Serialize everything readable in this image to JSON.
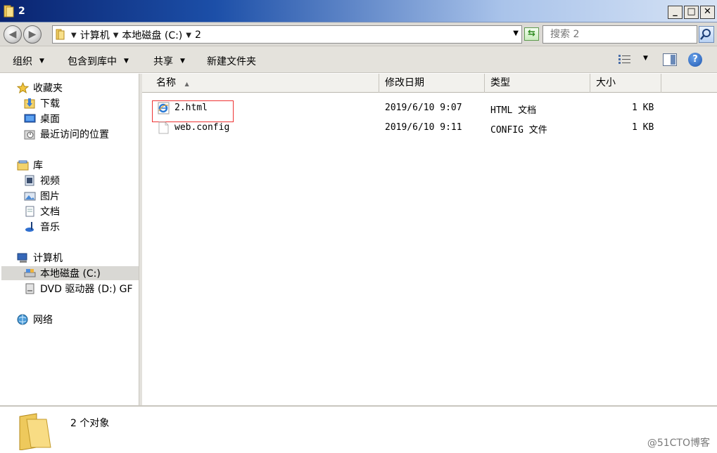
{
  "window": {
    "title": "2",
    "minimize": "_",
    "maximize": "□",
    "close": "✕"
  },
  "address": {
    "crumbs": [
      "计算机",
      "本地磁盘 (C:)",
      "2"
    ],
    "search_placeholder": "搜索 2"
  },
  "toolbar": {
    "organize": "组织",
    "include_library": "包含到库中",
    "share": "共享",
    "new_folder": "新建文件夹"
  },
  "nav": {
    "favorites": "收藏夹",
    "downloads": "下载",
    "desktop": "桌面",
    "recent": "最近访问的位置",
    "library": "库",
    "videos": "视频",
    "pictures": "图片",
    "documents": "文档",
    "music": "音乐",
    "computer": "计算机",
    "local_disk": "本地磁盘 (C:)",
    "dvd": "DVD 驱动器 (D:) GF",
    "network": "网络"
  },
  "columns": {
    "name": "名称",
    "modified": "修改日期",
    "type": "类型",
    "size": "大小"
  },
  "files": [
    {
      "name": "2.html",
      "modified": "2019/6/10 9:07",
      "type": "HTML 文档",
      "size": "1 KB",
      "icon": "ie-html-icon"
    },
    {
      "name": "web.config",
      "modified": "2019/6/10 9:11",
      "type": "CONFIG 文件",
      "size": "1 KB",
      "icon": "blank-file-icon"
    }
  ],
  "status": {
    "count_text": "2 个对象"
  },
  "watermark": "@51CTO博客",
  "colors": {
    "title_gradient_start": "#0a2470",
    "title_gradient_end": "#d6e3f5",
    "highlight_border": "#ee3333",
    "selected_nav": "#d9d8d4"
  }
}
